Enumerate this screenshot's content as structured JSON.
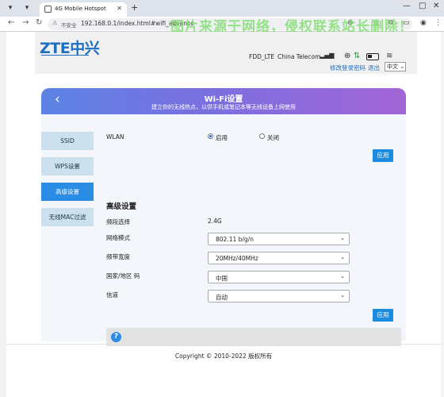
{
  "browser": {
    "tab_title": "4G Mobile Hotspot",
    "insecure_label": "不安全",
    "url": "192.168.0.1/index.html#wifi_advance",
    "watermark": "图片来源于网络，侵权联系站长删除！"
  },
  "header": {
    "logo": "ZTE中兴",
    "network_mode": "FDD_LTE",
    "operator": "China Telecom",
    "change_password_link": "修改登录密码",
    "logout_link": "退出",
    "language": "中文"
  },
  "banner": {
    "title": "Wi-Fi设置",
    "subtitle": "建立你的无线热点，以供手机或笔记本等无线设备上网使用"
  },
  "sidebar": {
    "items": [
      {
        "label": "SSID"
      },
      {
        "label": "WPS设置"
      },
      {
        "label": "高级设置"
      },
      {
        "label": "无线MAC过滤"
      }
    ]
  },
  "wlan": {
    "label": "WLAN",
    "enable_label": "启用",
    "disable_label": "关闭",
    "selected": "启用",
    "apply_label": "应用"
  },
  "advanced": {
    "title": "高级设置",
    "band_label": "频段选择",
    "band_value": "2.4G",
    "network_mode_label": "网络模式",
    "network_mode_value": "802.11 b/g/n",
    "bandwidth_label": "频带宽度",
    "bandwidth_value": "20MHz/40MHz",
    "country_label": "国家/地区 码",
    "country_value": "中国",
    "channel_label": "信道",
    "channel_value": "自动",
    "apply_label": "应用"
  },
  "footer": {
    "copyright": "Copyright © 2010-2022 版权所有"
  },
  "colors": {
    "accent": "#1c8ce0",
    "sidebar_inactive": "#cce0ee",
    "banner_start": "#5b84e4",
    "banner_end": "#a365d6",
    "logo": "#1e6fc0"
  }
}
